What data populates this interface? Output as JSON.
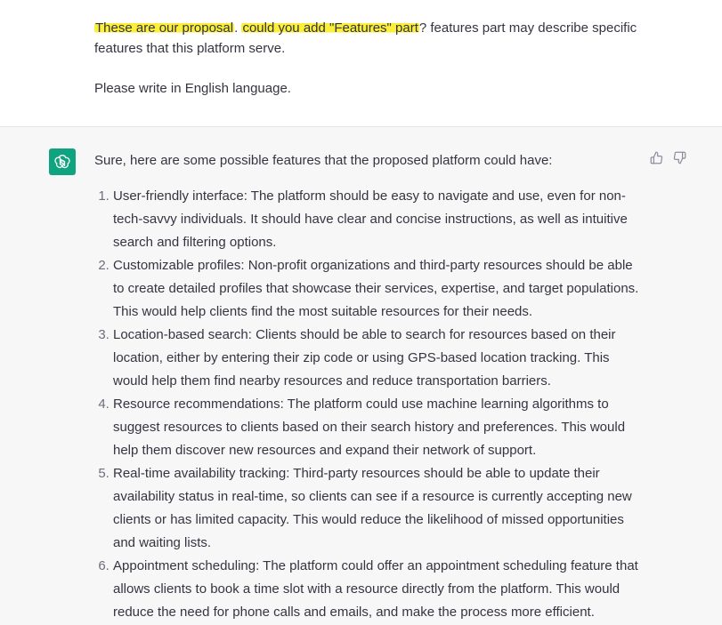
{
  "user_message": {
    "highlight_1": "These are our proposal",
    "sep": ". ",
    "highlight_2": "could you add \"Features\" part",
    "rest": "? features part may describe specific features that this platform serve.",
    "line2": "Please write in English language."
  },
  "assistant_message": {
    "intro": "Sure, here are some possible features that the proposed platform could have:",
    "features": [
      "User-friendly interface: The platform should be easy to navigate and use, even for non-tech-savvy individuals. It should have clear and concise instructions, as well as intuitive search and filtering options.",
      "Customizable profiles: Non-profit organizations and third-party resources should be able to create detailed profiles that showcase their services, expertise, and target populations. This would help clients find the most suitable resources for their needs.",
      "Location-based search: Clients should be able to search for resources based on their location, either by entering their zip code or using GPS-based location tracking. This would help them find nearby resources and reduce transportation barriers.",
      "Resource recommendations: The platform could use machine learning algorithms to suggest resources to clients based on their search history and preferences. This would help them discover new resources and expand their network of support.",
      "Real-time availability tracking: Third-party resources should be able to update their availability status in real-time, so clients can see if a resource is currently accepting new clients or has limited capacity. This would reduce the likelihood of missed opportunities and waiting lists.",
      "Appointment scheduling: The platform could offer an appointment scheduling feature that allows clients to book a time slot with a resource directly from the platform. This would reduce the need for phone calls and emails, and make the process more efficient."
    ]
  },
  "icons": {
    "avatar": "openai-logo-icon",
    "thumbs_up": "thumbs-up-icon",
    "thumbs_down": "thumbs-down-icon"
  },
  "colors": {
    "highlight": "#fbef3a",
    "avatar_bg": "#10a37f",
    "assistant_bg": "#f7f7f8",
    "text": "#343541"
  }
}
